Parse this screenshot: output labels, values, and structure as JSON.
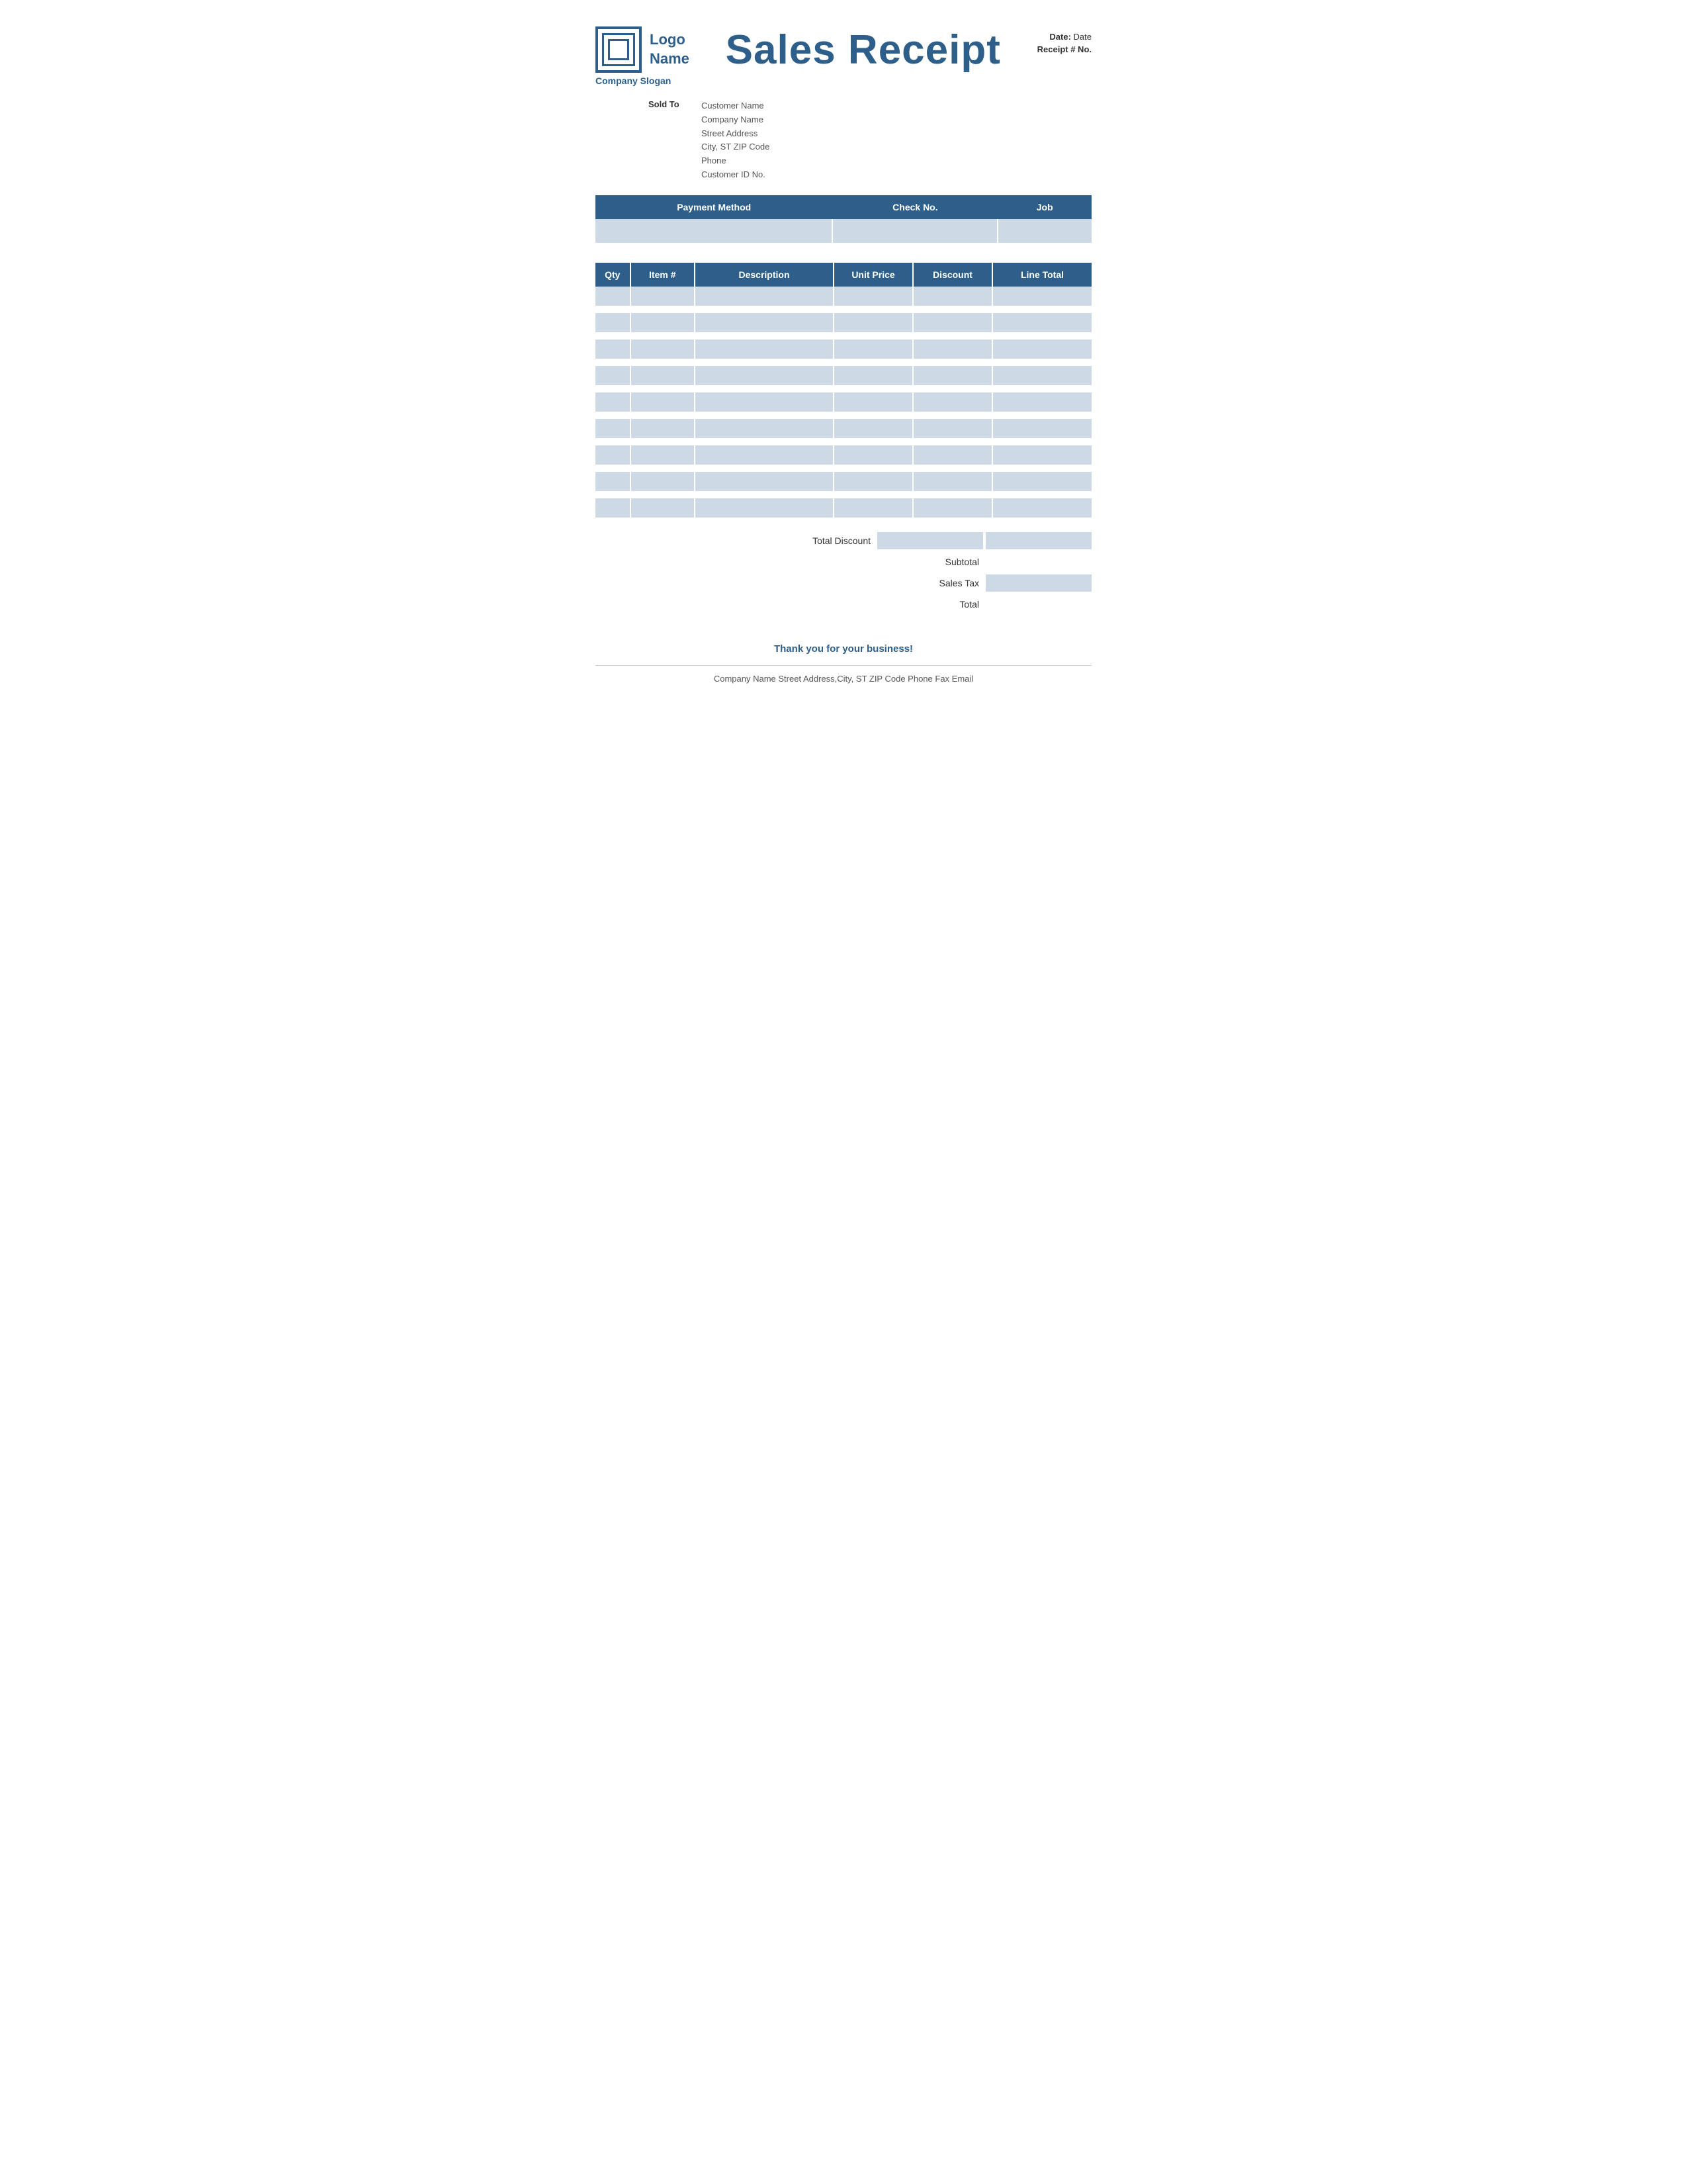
{
  "header": {
    "logo_name": "Logo\nName",
    "logo_line1": "Logo",
    "logo_line2": "Name",
    "title": "Sales Receipt",
    "slogan": "Company Slogan",
    "date_label": "Date:",
    "date_value": "Date",
    "receipt_label": "Receipt # No."
  },
  "sold_to": {
    "label": "Sold To",
    "customer_name": "Customer Name",
    "company_name": "Company Name",
    "street": "Street Address",
    "city": "City, ST  ZIP Code",
    "phone": "Phone",
    "customer_id": "Customer ID No."
  },
  "payment_table": {
    "headers": [
      "Payment Method",
      "Check No.",
      "Job"
    ],
    "row": [
      "",
      "",
      ""
    ]
  },
  "items_table": {
    "headers": [
      "Qty",
      "Item #",
      "Description",
      "Unit Price",
      "Discount",
      "Line Total"
    ],
    "rows": 9
  },
  "totals": {
    "total_discount_label": "Total Discount",
    "subtotal_label": "Subtotal",
    "sales_tax_label": "Sales Tax",
    "total_label": "Total"
  },
  "footer": {
    "thank_you": "Thank you for your business!",
    "company_info": "Company Name   Street Address,City, ST  ZIP Code   Phone   Fax   Email"
  }
}
